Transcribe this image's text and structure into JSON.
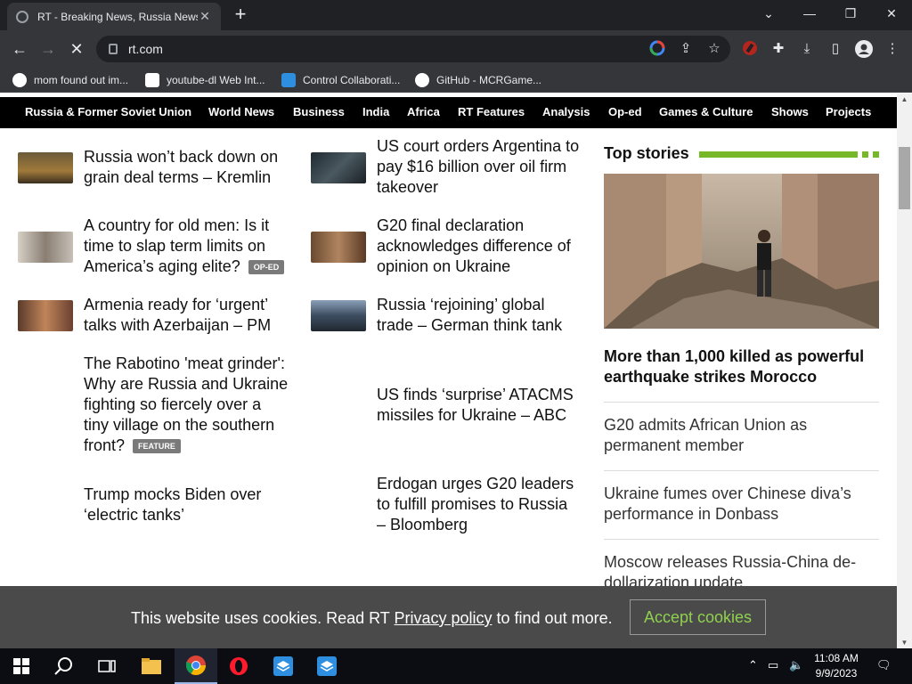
{
  "browser": {
    "tab_title": "RT - Breaking News, Russia News",
    "tab_close": "✕",
    "new_tab": "+",
    "url": "rt.com",
    "bookmarks": [
      {
        "label": "mom found out im...",
        "icon": "google-icon"
      },
      {
        "label": "youtube-dl Web Int...",
        "icon": "youtube-dl-icon"
      },
      {
        "label": "Control Collaborati...",
        "icon": "monitor-icon"
      },
      {
        "label": "GitHub - MCRGame...",
        "icon": "github-icon"
      }
    ]
  },
  "site_nav": [
    "Russia & Former Soviet Union",
    "World News",
    "Business",
    "India",
    "Africa",
    "RT Features",
    "Analysis",
    "Op-ed",
    "Games & Culture",
    "Shows",
    "Projects"
  ],
  "col1": [
    {
      "title_lines": [
        "Russia won’t back down on",
        "grain deal terms – Kremlin"
      ]
    },
    {
      "title_lines": [
        "A country for old men: Is it",
        "time to slap term limits on",
        "America’s aging elite?"
      ],
      "badge": "OP-ED"
    },
    {
      "title_lines": [
        "Armenia ready for ‘urgent’",
        "talks with Azerbaijan – PM"
      ]
    },
    {
      "title_lines": [
        "The Rabotino 'meat grinder':",
        "Why are Russia and Ukraine",
        "fighting so fiercely over a",
        "tiny village on the southern",
        "front?"
      ],
      "badge": "FEATURE"
    },
    {
      "title_lines": [
        "Trump mocks Biden over",
        "‘electric tanks’"
      ]
    }
  ],
  "col2": [
    {
      "title_lines": [
        "US court orders Argentina to",
        "pay $16 billion over oil firm",
        "takeover"
      ]
    },
    {
      "title_lines": [
        "G20 final declaration",
        "acknowledges difference of",
        "opinion on Ukraine"
      ]
    },
    {
      "title_lines": [
        "Russia ‘rejoining’ global",
        "trade – German think tank"
      ]
    },
    {
      "title_lines": [
        "US finds ‘surprise’ ATACMS",
        "missiles for Ukraine – ABC"
      ]
    },
    {
      "title_lines": [
        "Erdogan urges G20 leaders",
        "to fulfill promises to Russia",
        "– Bloomberg"
      ]
    }
  ],
  "top_stories": {
    "heading": "Top stories",
    "lead_lines": [
      "More than 1,000 killed as powerful",
      "earthquake strikes Morocco"
    ],
    "items": [
      [
        "G20 admits African Union as",
        "permanent member"
      ],
      [
        "Ukraine fumes over Chinese diva’s",
        "performance in Donbass"
      ],
      [
        "Moscow releases Russia-China de-",
        "dollarization update"
      ]
    ],
    "accent": "#77b82a"
  },
  "cookie": {
    "text_before": "This website uses cookies. Read RT ",
    "link": "Privacy policy",
    "text_after": " to find out more.",
    "button": "Accept cookies"
  },
  "taskbar": {
    "time": "11:08 AM",
    "date": "9/9/2023"
  }
}
